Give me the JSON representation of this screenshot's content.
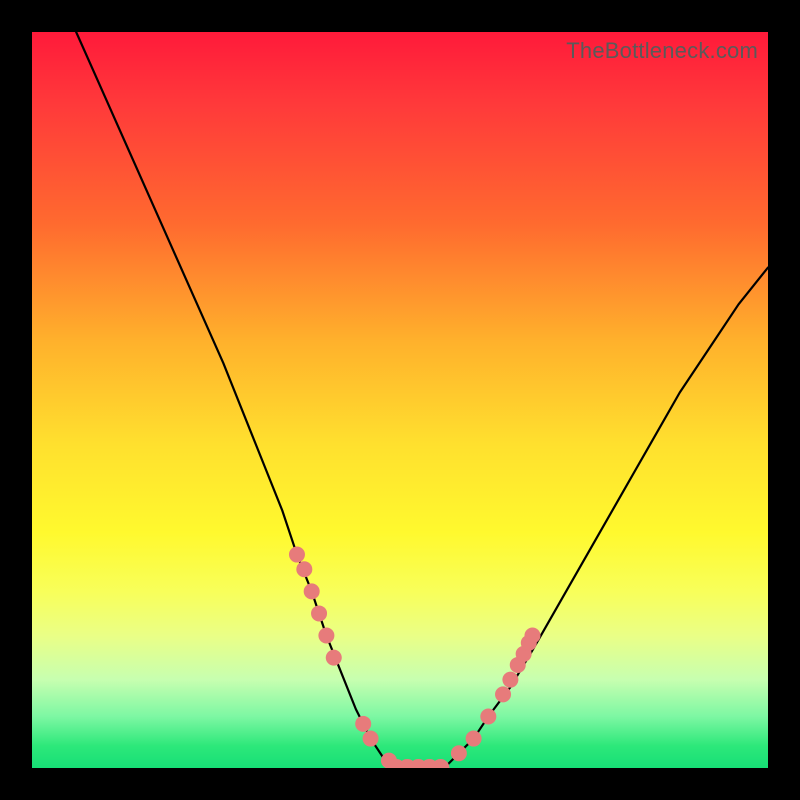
{
  "watermark": "TheBottleneck.com",
  "chart_data": {
    "type": "line",
    "title": "",
    "xlabel": "",
    "ylabel": "",
    "xlim": [
      0,
      100
    ],
    "ylim": [
      0,
      100
    ],
    "series": [
      {
        "name": "left-curve",
        "x": [
          6,
          10,
          14,
          18,
          22,
          26,
          30,
          34,
          36,
          38,
          40,
          42,
          44,
          46,
          48,
          50
        ],
        "y": [
          100,
          91,
          82,
          73,
          64,
          55,
          45,
          35,
          29,
          24,
          18,
          13,
          8,
          4,
          1,
          0
        ]
      },
      {
        "name": "flat-bottom",
        "x": [
          50,
          53,
          56
        ],
        "y": [
          0,
          0,
          0
        ]
      },
      {
        "name": "right-curve",
        "x": [
          56,
          58,
          60,
          62,
          65,
          68,
          72,
          76,
          80,
          84,
          88,
          92,
          96,
          100
        ],
        "y": [
          0,
          2,
          4,
          7,
          11,
          16,
          23,
          30,
          37,
          44,
          51,
          57,
          63,
          68
        ]
      }
    ],
    "markers": [
      {
        "group": "left-upper",
        "points": [
          [
            36,
            29
          ],
          [
            37,
            27
          ],
          [
            38,
            24
          ],
          [
            39,
            21
          ],
          [
            40,
            18
          ],
          [
            41,
            15
          ]
        ]
      },
      {
        "group": "left-lower",
        "points": [
          [
            45,
            6
          ],
          [
            46,
            4
          ],
          [
            48.5,
            1
          ]
        ]
      },
      {
        "group": "bottom-bar",
        "points": [
          [
            49.5,
            0
          ],
          [
            51,
            0
          ],
          [
            52.5,
            0
          ],
          [
            54,
            0
          ],
          [
            55.5,
            0
          ]
        ]
      },
      {
        "group": "right-lower",
        "points": [
          [
            58,
            2
          ],
          [
            60,
            4
          ],
          [
            62,
            7
          ]
        ]
      },
      {
        "group": "right-upper",
        "points": [
          [
            64,
            10
          ],
          [
            65,
            12
          ],
          [
            66,
            14
          ],
          [
            66.8,
            15.5
          ],
          [
            67.5,
            17
          ],
          [
            68,
            18
          ]
        ]
      }
    ],
    "gradient_stops": [
      {
        "pos": 0,
        "color": "#ff1a3a"
      },
      {
        "pos": 10,
        "color": "#ff3a3a"
      },
      {
        "pos": 26,
        "color": "#ff6a2f"
      },
      {
        "pos": 42,
        "color": "#ffb12c"
      },
      {
        "pos": 56,
        "color": "#ffe02e"
      },
      {
        "pos": 68,
        "color": "#fff92e"
      },
      {
        "pos": 76,
        "color": "#f8ff5a"
      },
      {
        "pos": 82,
        "color": "#eaff86"
      },
      {
        "pos": 88,
        "color": "#c7ffb0"
      },
      {
        "pos": 93,
        "color": "#7df7a3"
      },
      {
        "pos": 97,
        "color": "#2de87a"
      },
      {
        "pos": 100,
        "color": "#17df76"
      }
    ]
  }
}
